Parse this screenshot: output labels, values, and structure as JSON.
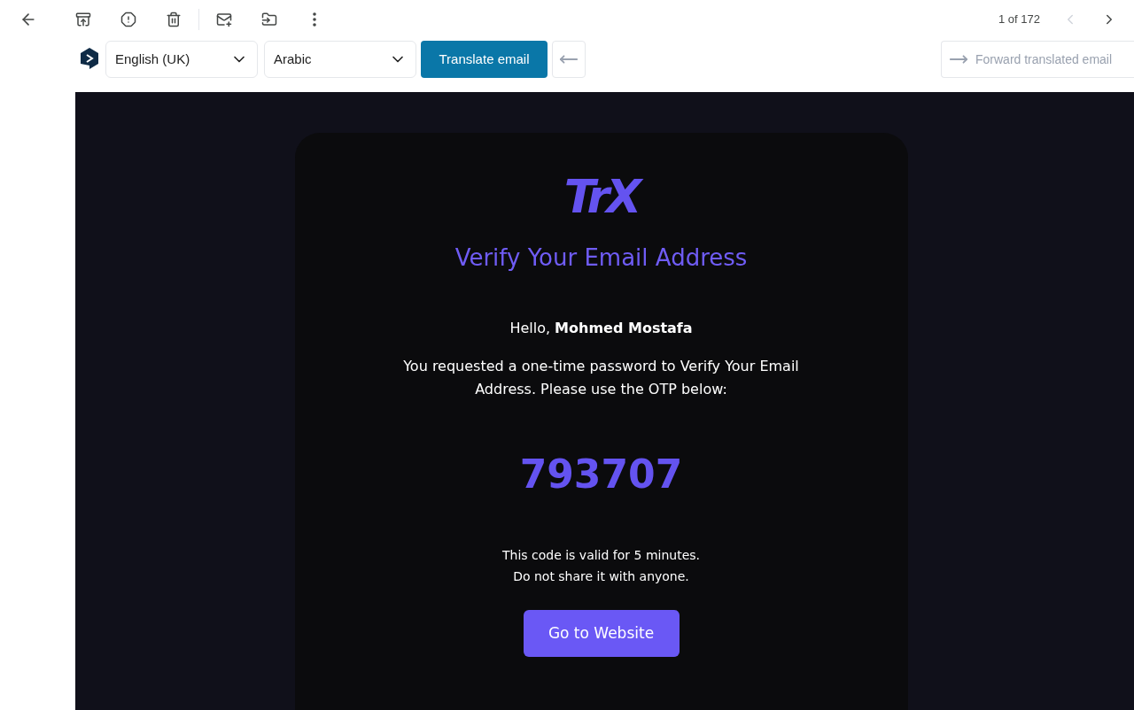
{
  "toolbar": {
    "pager": "1 of 172",
    "prev_disabled": true,
    "next_disabled": false
  },
  "translate_bar": {
    "source_language": "English (UK)",
    "target_language": "Arabic",
    "translate_button": "Translate email",
    "forward_button": "Forward translated email"
  },
  "email": {
    "logo": "TrX",
    "title": "Verify Your Email Address",
    "greeting": "Hello, **Mohmed Mostafa**",
    "message": "You requested a one-time password to Verify Your Email Address. Please use the OTP below:",
    "otp": "793707",
    "validity": [
      "This code is valid for 5 minutes.",
      "Do not share it with anyone."
    ],
    "button": "Go to Website"
  }
}
